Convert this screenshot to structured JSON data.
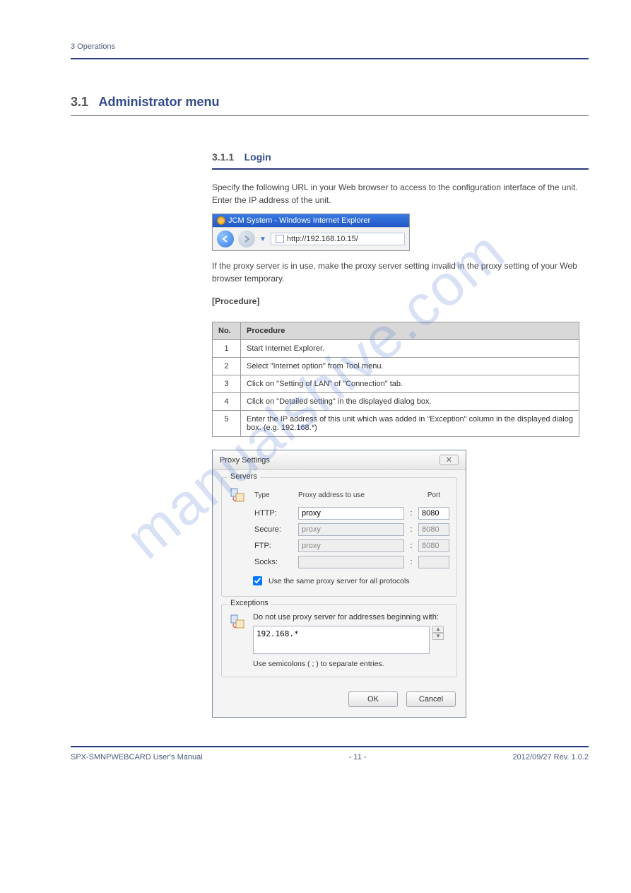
{
  "meta": {
    "header_line": "3 Operations"
  },
  "watermark": "manualshive.com",
  "section": {
    "num": "3.1",
    "title": "Administrator menu"
  },
  "subsection": {
    "num": "3.1.1",
    "title": "Login"
  },
  "intro1": "Specify the following URL in your Web browser to access to the configuration interface of the unit. Enter the IP address of the unit.",
  "intro2": "If the proxy server is in use, make the proxy server setting invalid in the proxy setting of your Web browser temporary.",
  "ie": {
    "title": "JCM System - Windows Internet Explorer",
    "url": "http://192.168.10.15/"
  },
  "proc_label": "[Procedure]",
  "table": {
    "h_no": "No.",
    "h_proc": "Procedure",
    "rows": [
      {
        "no": "1",
        "proc": "Start Internet Explorer."
      },
      {
        "no": "2",
        "proc": "Select \"Internet option\" from Tool menu."
      },
      {
        "no": "3",
        "proc": "Click on \"Setting of LAN\" of \"Connection\" tab."
      },
      {
        "no": "4",
        "proc": "Click on \"Detailed setting\" in the displayed dialog box."
      },
      {
        "no": "5",
        "proc": "Enter the IP address of this unit which was added in \"Exception\" column in the displayed dialog box. (e.g. 192.168.*)"
      }
    ]
  },
  "proxy": {
    "title": "Proxy Settings",
    "servers_label": "Servers",
    "type": "Type",
    "addr": "Proxy address to use",
    "port": "Port",
    "http": "HTTP:",
    "secure": "Secure:",
    "ftp": "FTP:",
    "socks": "Socks:",
    "val_proxy": "proxy",
    "val_port": "8080",
    "same": "Use the same proxy server for all protocols",
    "exceptions_label": "Exceptions",
    "exc_text": "Do not use proxy server for addresses beginning with:",
    "exc_value": "192.168.*",
    "exc_hint": "Use semicolons ( ; ) to separate entries.",
    "ok": "OK",
    "cancel": "Cancel"
  },
  "footer": {
    "left": "SPX-SMNPWEBCARD User's Manual",
    "middle": "- 11 -",
    "right": "2012/09/27 Rev. 1.0.2"
  }
}
